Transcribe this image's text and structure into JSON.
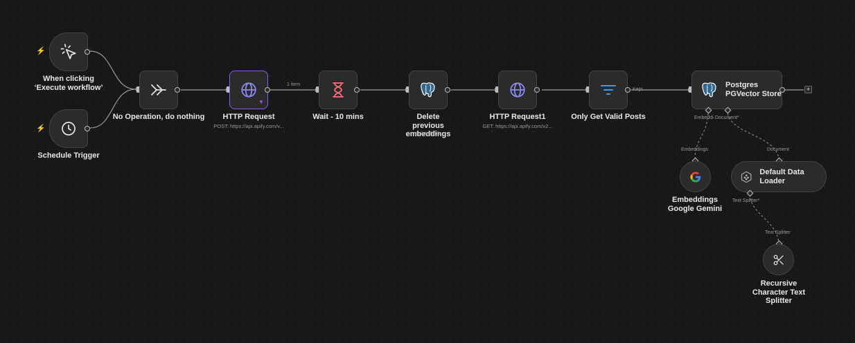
{
  "nodes": {
    "manual_trigger": {
      "name": "When clicking ‘Execute workflow’",
      "icon": "cursor-click-icon"
    },
    "schedule_trigger": {
      "name": "Schedule Trigger",
      "icon": "clock-icon"
    },
    "no_op": {
      "name": "No Operation, do nothing",
      "icon": "double-arrow-icon"
    },
    "http_request": {
      "name": "HTTP Request",
      "subtitle": "POST: https://api.apify.com/v...",
      "icon": "globe-icon"
    },
    "wait": {
      "name": "Wait - 10 mins",
      "icon": "hourglass-icon"
    },
    "delete_embeddings": {
      "name": "Delete previous embeddings",
      "subtitle": "deleteTable",
      "icon": "postgres-icon"
    },
    "http_request1": {
      "name": "HTTP Request1",
      "subtitle": "GET: https://api.apify.com/v2...",
      "icon": "globe-icon"
    },
    "filter": {
      "name": "Only Get Valid Posts",
      "icon": "filter-icon"
    },
    "pg_vector": {
      "name_line1": "Postgres",
      "name_line2": "PGVector Store",
      "icon": "postgres-icon"
    },
    "embeddings": {
      "name": "Embeddings Google Gemini",
      "icon": "google-icon"
    },
    "data_loader": {
      "name": "Default Data Loader",
      "icon": "data-loader-icon"
    },
    "text_splitter": {
      "name": "Recursive Character Text Splitter",
      "icon": "scissors-icon"
    }
  },
  "edge_labels": {
    "items": "1 item",
    "kept": "Kept",
    "embedding_port": "Embeddi",
    "document_port": "Document*",
    "embeddings": "Embeddings",
    "document": "Document",
    "text_splitter_port": "Text Splitter*",
    "text_splitter": "Text Splitter"
  },
  "add_button": "+",
  "colors": {
    "canvas": "#181818",
    "node": "#2b2b2b",
    "selected": "#8b5cf6",
    "trigger_bolt": "#ff6b2c",
    "http_icon": "#8c8cf6",
    "wait_icon": "#ff6f7a",
    "filter_icon": "#3d9cf0",
    "postgres_icon": "#336791"
  }
}
